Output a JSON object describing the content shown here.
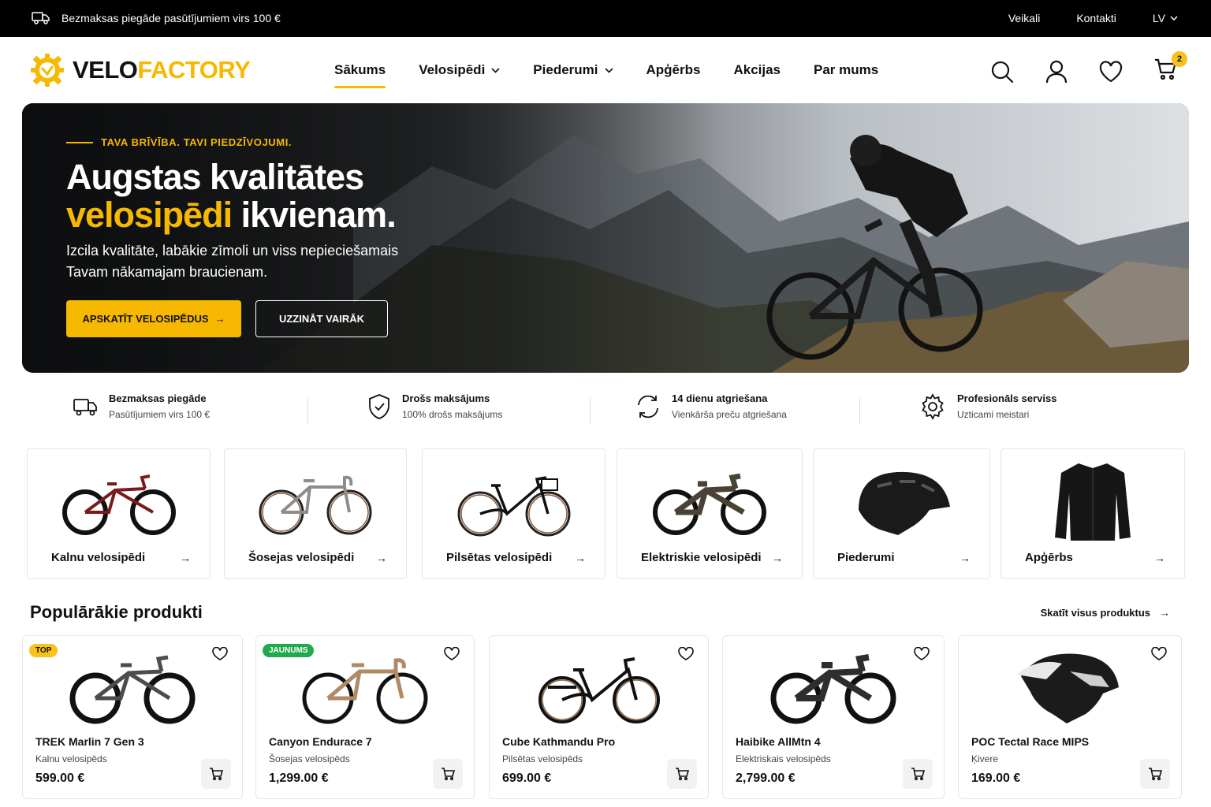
{
  "topbar": {
    "shipping_text": "Bezmaksas piegāde pasūtījumiem virs 100 €",
    "links": [
      "Veikali",
      "Kontakti"
    ],
    "language": "LV"
  },
  "header": {
    "logo_part1": "VELO",
    "logo_part2": "FACTORY",
    "nav": [
      {
        "label": "Sākums",
        "active": true
      },
      {
        "label": "Velosipēdi",
        "dropdown": true
      },
      {
        "label": "Piederumi",
        "dropdown": true
      },
      {
        "label": "Apģērbs"
      },
      {
        "label": "Akcijas"
      },
      {
        "label": "Par mums"
      }
    ],
    "cart_count": "2",
    "icons": [
      "search-icon",
      "user-icon",
      "heart-icon",
      "cart-icon"
    ]
  },
  "hero": {
    "kicker": "TAVA BRĪVĪBA. TAVI PIEDZĪVOJUMI.",
    "title_line1": "Augstas kvalitātes",
    "title_highlight": "velosipēdi",
    "title_rest": " ikvienam.",
    "subtitle_line1": "Izcila kvalitāte, labākie zīmoli un viss nepieciešamais",
    "subtitle_line2": "Tavam nākamajam braucienam.",
    "primary_button": "APSKATĪT VELOSIPĒDUS",
    "secondary_button": "UZZINĀT VAIRĀK"
  },
  "features": [
    {
      "title": "Bezmaksas piegāde",
      "subtitle": "Pasūtījumiem virs 100 €",
      "icon": "truck-icon"
    },
    {
      "title": "Drošs maksājums",
      "subtitle": "100% drošs maksājums",
      "icon": "shield-icon"
    },
    {
      "title": "14 dienu atgriešana",
      "subtitle": "Vienkārša preču atgriešana",
      "icon": "return-icon"
    },
    {
      "title": "Profesionāls serviss",
      "subtitle": "Uzticami meistari",
      "icon": "gear-icon"
    }
  ],
  "categories": [
    {
      "label": "Kalnu velosipēdi"
    },
    {
      "label": "Šosejas velosipēdi"
    },
    {
      "label": "Pilsētas velosipēdi"
    },
    {
      "label": "Elektriskie velosipēdi"
    },
    {
      "label": "Piederumi"
    },
    {
      "label": "Apģērbs"
    }
  ],
  "popular": {
    "title": "Populārākie produkti",
    "see_all": "Skatīt visus produktus",
    "products": [
      {
        "tag": "TOP",
        "name": "TREK Marlin 7 Gen 3",
        "category": "Kalnu velosipēds",
        "price": "599.00 €"
      },
      {
        "tag": "JAUNUMS",
        "name": "Canyon Endurace 7",
        "category": "Šosejas velosipēds",
        "price": "1,299.00 €"
      },
      {
        "name": "Cube Kathmandu Pro",
        "category": "Pilsētas velosipēds",
        "price": "699.00 €"
      },
      {
        "name": "Haibike AllMtn 4",
        "category": "Elektriskais velosipēds",
        "price": "2,799.00 €"
      },
      {
        "name": "POC Tectal Race MIPS",
        "category": "Ķivere",
        "price": "169.00 €"
      }
    ]
  },
  "colors": {
    "accent": "#f6b800",
    "topbar": "#000000",
    "tag_top": "#f6c21b",
    "tag_new": "#1faa4b"
  }
}
